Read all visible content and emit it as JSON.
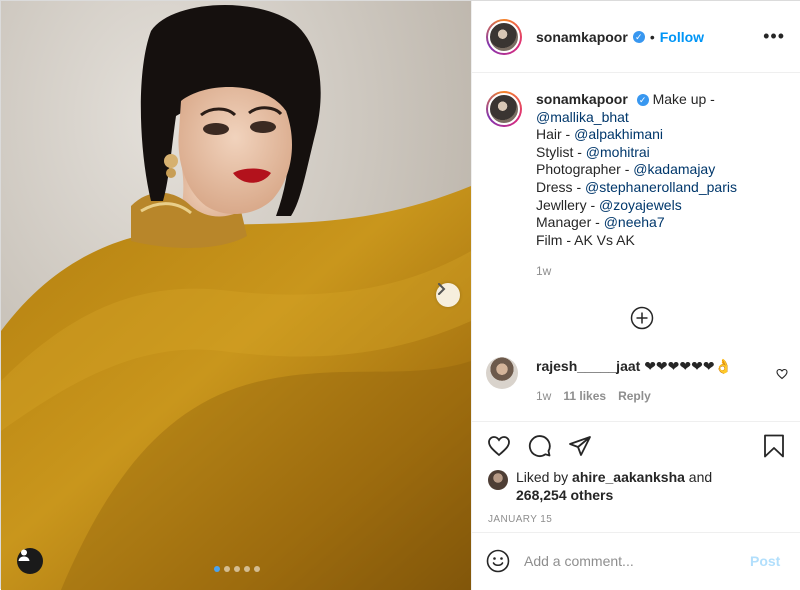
{
  "post": {
    "author": "sonamkapoor",
    "separator": "•",
    "follow_label": "Follow",
    "more_label": "•••",
    "verified_mark": "✓"
  },
  "caption": {
    "username": "sonamkapoor",
    "lines": [
      {
        "prefix": "Make up - ",
        "mention": ""
      },
      {
        "prefix": "",
        "mention": "@mallika_bhat"
      },
      {
        "prefix": "Hair - ",
        "mention": "@alpakhimani"
      },
      {
        "prefix": "Stylist - ",
        "mention": "@mohitrai"
      },
      {
        "prefix": "Photographer - ",
        "mention": "@kadamajay"
      },
      {
        "prefix": "Dress - ",
        "mention": "@stephanerolland_paris"
      },
      {
        "prefix": "Jewllery - ",
        "mention": "@zoyajewels"
      },
      {
        "prefix": "Manager - ",
        "mention": "@neeha7"
      },
      {
        "prefix": "Film - AK Vs AK",
        "mention": ""
      }
    ],
    "time": "1w"
  },
  "comment": {
    "username": "rajesh_____jaat",
    "text": " ❤❤❤❤❤❤👌",
    "time": "1w",
    "likes": "11 likes",
    "reply": "Reply"
  },
  "likes": {
    "prefix": "Liked by ",
    "user": "ahire_aakanksha",
    "and": " and",
    "others": "268,254 others"
  },
  "date": "JANUARY 15",
  "add_comment": {
    "placeholder": "Add a comment...",
    "post_label": "Post"
  },
  "carousel": {
    "total": 5,
    "active_index": 0
  },
  "colors": {
    "accent": "#0095f6",
    "verified": "#3897f0",
    "mention": "#00376b",
    "post_disabled": "#b2dffc",
    "muted": "#8e8e8e"
  }
}
